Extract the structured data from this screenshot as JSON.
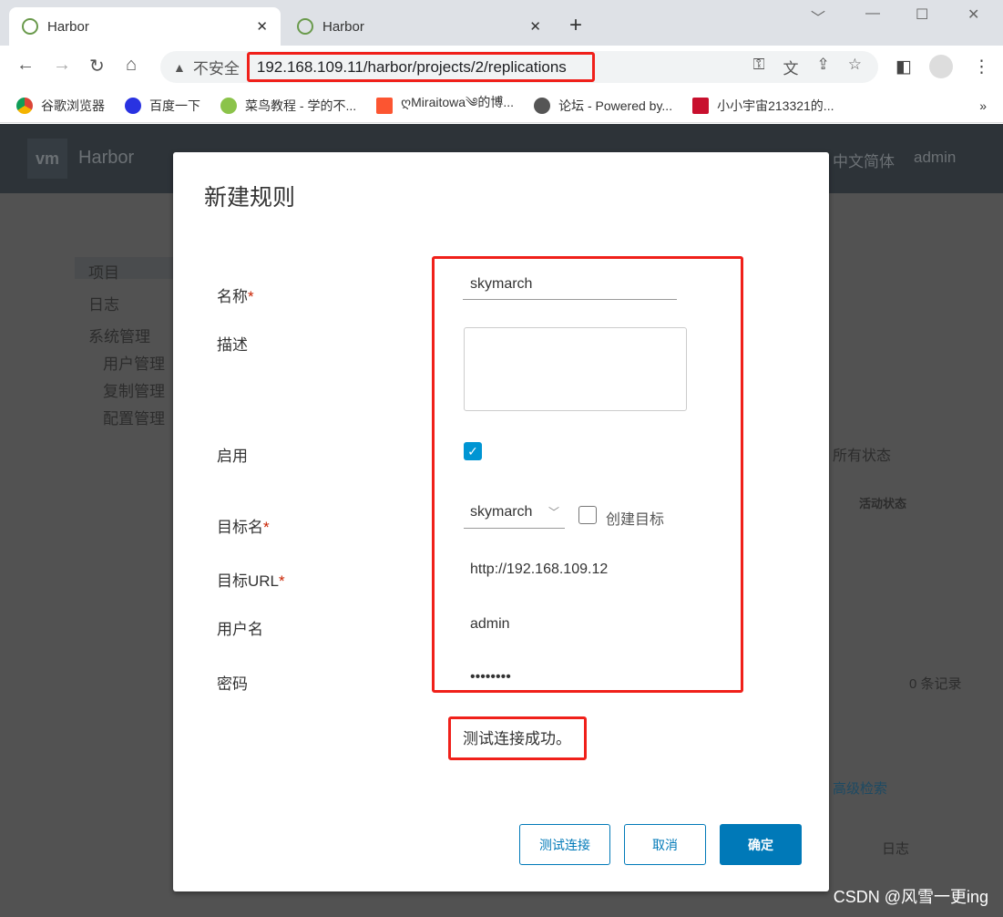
{
  "browser": {
    "tabs": [
      {
        "title": "Harbor",
        "close": "✕"
      },
      {
        "title": "Harbor",
        "close": "✕"
      }
    ],
    "new_tab": "+",
    "window_controls": [
      "﹀",
      "—",
      "☐",
      "✕"
    ],
    "insecure_label": "不安全",
    "url": "192.168.109.11/harbor/projects/2/replications",
    "bookmarks": [
      "谷歌浏览器",
      "百度一下",
      "菜鸟教程 - 学的不...",
      "ღMiraitowa༄的博...",
      "论坛 - Powered by...",
      "小小宇宙213321的..."
    ],
    "bookmarks_more": "»"
  },
  "harbor": {
    "logo": "vm",
    "brand": "Harbor",
    "language": "中文简体",
    "user": "admin",
    "sidebar": [
      "项目",
      "日志",
      "系统管理",
      "用户管理",
      "复制管理",
      "配置管理"
    ],
    "status_filter": "所有状态",
    "column_status": "活动状态",
    "record_count": "0 条记录",
    "advanced_search": "高级检索",
    "column_log": "日志"
  },
  "modal": {
    "title": "新建规则",
    "fields": {
      "name_label": "名称",
      "name_value": "skymarch",
      "desc_label": "描述",
      "desc_value": "",
      "enable_label": "启用",
      "enabled": true,
      "target_label": "目标名",
      "target_value": "skymarch",
      "create_target_label": "创建目标",
      "create_target_checked": false,
      "url_label": "目标URL",
      "url_value": "http://192.168.109.12",
      "user_label": "用户名",
      "user_value": "admin",
      "password_label": "密码",
      "password_value": "••••••••"
    },
    "required_mark": "*",
    "test_result": "测试连接成功。",
    "buttons": {
      "test": "测试连接",
      "cancel": "取消",
      "ok": "确定"
    }
  },
  "watermark": "CSDN @风雪一更ing",
  "colors": {
    "accent": "#0079b8",
    "highlight": "#f0201a",
    "header": "#313d45"
  }
}
